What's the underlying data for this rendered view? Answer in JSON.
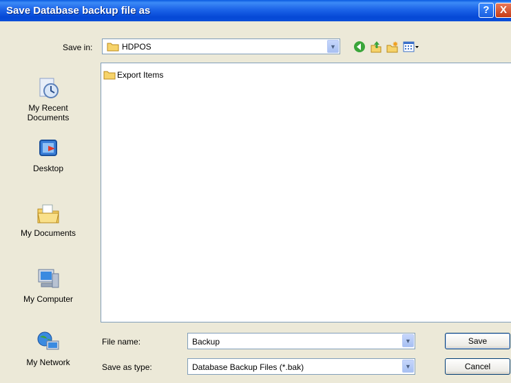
{
  "window": {
    "title": "Save Database backup file as",
    "help_label": "?",
    "close_label": "X"
  },
  "toolbar": {
    "save_in_label": "Save in:",
    "save_in_value": "HDPOS",
    "icons": [
      "back-icon",
      "up-folder-icon",
      "new-folder-icon",
      "view-menu-icon"
    ]
  },
  "places": [
    {
      "label": "My Recent\nDocuments",
      "line1": "My Recent",
      "line2": "Documents",
      "icon": "recent-documents-icon"
    },
    {
      "label": "Desktop",
      "icon": "desktop-icon"
    },
    {
      "label": "My Documents",
      "icon": "my-documents-icon"
    },
    {
      "label": "My Computer",
      "icon": "my-computer-icon"
    },
    {
      "label": "My Network",
      "icon": "my-network-icon"
    }
  ],
  "files": [
    {
      "name": "Export Items",
      "icon": "folder-icon"
    }
  ],
  "form": {
    "file_name_label": "File name:",
    "file_name_value": "Backup",
    "save_as_type_label": "Save as type:",
    "save_as_type_value": "Database Backup Files (*.bak)"
  },
  "buttons": {
    "save_label": "Save",
    "cancel_label": "Cancel"
  },
  "colors": {
    "titlebar": "#0a4fd9",
    "face": "#ece9d8",
    "border": "#7f9db9"
  }
}
